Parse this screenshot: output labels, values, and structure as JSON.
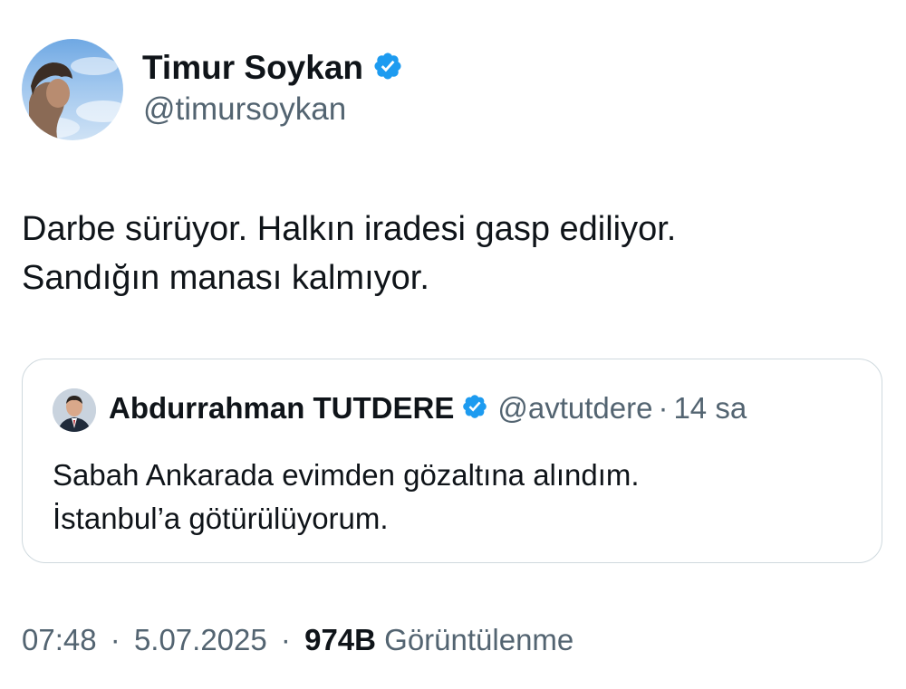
{
  "author": {
    "name": "Timur Soykan",
    "handle": "@timursoykan",
    "verified": true
  },
  "tweet": {
    "lines": [
      "Darbe sürüyor. Halkın iradesi gasp ediliyor.",
      "Sandığın manası kalmıyor."
    ]
  },
  "quoted_tweet": {
    "author_name": "Abdurrahman TUTDERE",
    "handle": "@avtutdere",
    "separator": "·",
    "time": "14 sa",
    "verified": true,
    "lines": [
      "Sabah Ankarada evimden gözaltına alındım.",
      "İstanbul’a götürülüyorum."
    ]
  },
  "meta": {
    "time": "07:48",
    "separator": "·",
    "date": "5.07.2025",
    "views_count": "974B",
    "views_label": "Görüntülenme"
  },
  "colors": {
    "verified": "#1d9bf0",
    "secondary_text": "#536471",
    "primary_text": "#0f1419",
    "border": "#cfd9de"
  },
  "icons": {
    "verified": "verified-badge-icon"
  }
}
